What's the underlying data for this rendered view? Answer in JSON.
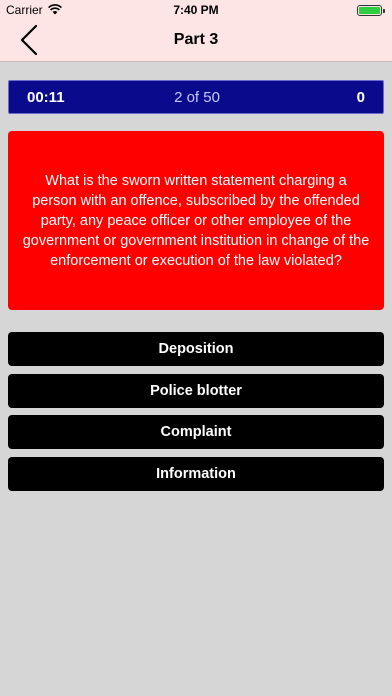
{
  "status_bar": {
    "carrier": "Carrier",
    "time": "7:40 PM",
    "wifi_icon": "wifi-icon",
    "battery_icon": "battery-icon",
    "battery_color": "#2ecc40"
  },
  "nav": {
    "back_icon": "chevron-left-icon",
    "title": "Part 3",
    "background": "#fde5e5"
  },
  "quiz_bar": {
    "timer": "00:11",
    "progress": "2 of 50",
    "score": "0",
    "background": "#0a0a8c"
  },
  "question": {
    "text": "What is the sworn written statement charging a person with an offence, subscribed by the offended party, any peace officer or other employee of the government or government institution in change of the enforcement or execution of the law violated?",
    "background": "#ff0000"
  },
  "answers": [
    {
      "label": "Deposition"
    },
    {
      "label": "Police blotter"
    },
    {
      "label": "Complaint"
    },
    {
      "label": "Information"
    }
  ]
}
